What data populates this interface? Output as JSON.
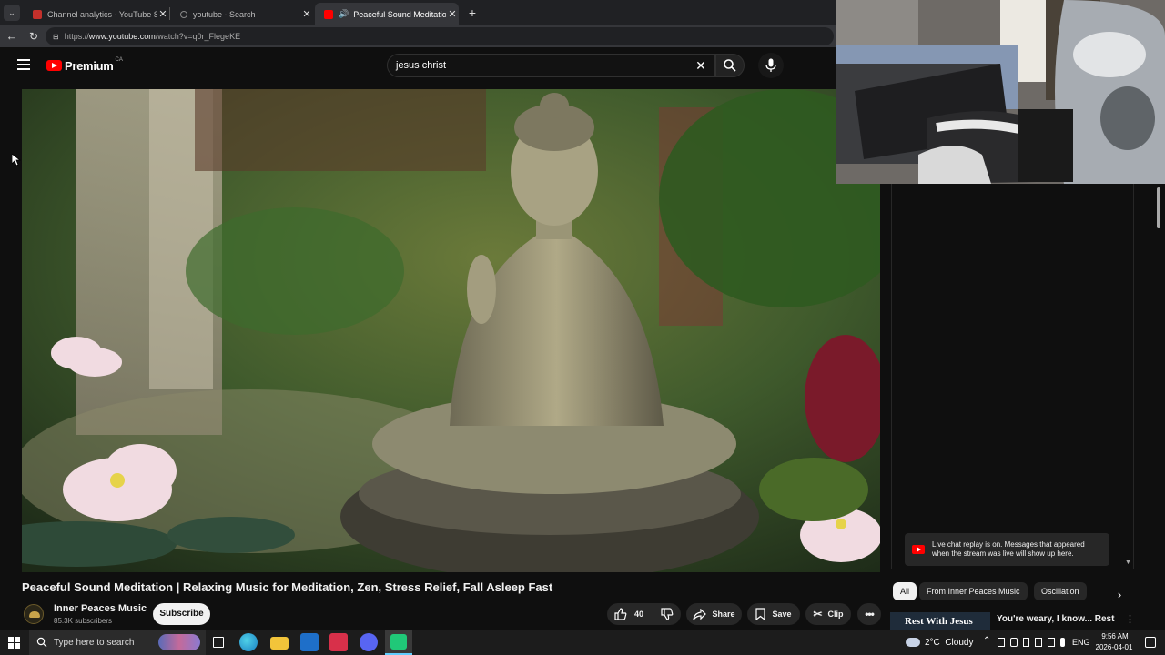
{
  "browser": {
    "tabs": [
      {
        "title": "Channel analytics - YouTube Studi"
      },
      {
        "title": "youtube - Search"
      },
      {
        "title": "Peaceful Sound Meditation | R"
      }
    ],
    "url_prefix": "https://",
    "url_host": "www.youtube.com",
    "url_path": "/watch?v=q0r_FlegeKE"
  },
  "youtube": {
    "logo": "Premium",
    "region": "CA",
    "search_value": "jesus christ"
  },
  "video": {
    "title": "Peaceful Sound Meditation | Relaxing Music for Meditation, Zen, Stress Relief, Fall Asleep Fast",
    "channel": "Inner Peaces Music",
    "subscribers": "85.3K subscribers",
    "subscribe_label": "Subscribe",
    "likes": "40",
    "share_label": "Share",
    "save_label": "Save",
    "clip_label": "Clip"
  },
  "chat": {
    "notice": "Live chat replay is on. Messages that appeared when the stream was live will show up here."
  },
  "chips": [
    "All",
    "From Inner Peaces Music",
    "Oscillation"
  ],
  "recommendation": {
    "thumb_text": "Rest With Jesus",
    "title": "You're weary, I know... Rest by"
  },
  "taskbar": {
    "search_placeholder": "Type here to search",
    "weather": "2°C  Cloudy",
    "lang": "ENG",
    "time": "9:56 AM",
    "date": "2026-04-01"
  },
  "colors": {
    "youtube_red": "#ff0000",
    "taskbar_bg": "#1c1c1c",
    "page_bg": "#0f0f0f"
  }
}
